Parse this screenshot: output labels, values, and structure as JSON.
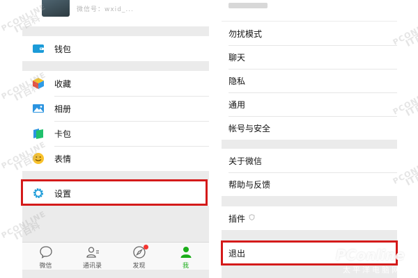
{
  "left": {
    "profile_sub": "微信号：wxid_...",
    "wallet": {
      "label": "钱包",
      "icon": "wallet-icon"
    },
    "items": [
      {
        "label": "收藏",
        "icon": "favorites-cube-icon"
      },
      {
        "label": "相册",
        "icon": "photo-album-icon"
      },
      {
        "label": "卡包",
        "icon": "card-pack-icon"
      },
      {
        "label": "表情",
        "icon": "smiley-sticker-icon"
      }
    ],
    "settings": {
      "label": "设置",
      "icon": "gear-icon"
    }
  },
  "tabbar": [
    {
      "label": "微信",
      "icon": "chat-bubble-icon"
    },
    {
      "label": "通讯录",
      "icon": "contacts-icon"
    },
    {
      "label": "发现",
      "icon": "compass-icon",
      "badge": true
    },
    {
      "label": "我",
      "icon": "person-icon",
      "active": true
    }
  ],
  "right": {
    "group1": [
      {
        "label": "勿扰模式"
      },
      {
        "label": "聊天"
      },
      {
        "label": "隐私"
      },
      {
        "label": "通用"
      },
      {
        "label": "帐号与安全"
      }
    ],
    "group2": [
      {
        "label": "关于微信"
      },
      {
        "label": "帮助与反馈"
      }
    ],
    "plugin": {
      "label": "插件",
      "icon": "shield-small-icon"
    },
    "logout": {
      "label": "退出"
    }
  },
  "watermark": {
    "brand": "PConline",
    "cn": "太平洋电脑网",
    "small_a": "PCONLINE",
    "small_b": "IT百科"
  },
  "colors": {
    "accent_green": "#1aad19",
    "highlight_red": "#d41a1a",
    "badge_red": "#f43530",
    "bg": "#ebebeb"
  }
}
